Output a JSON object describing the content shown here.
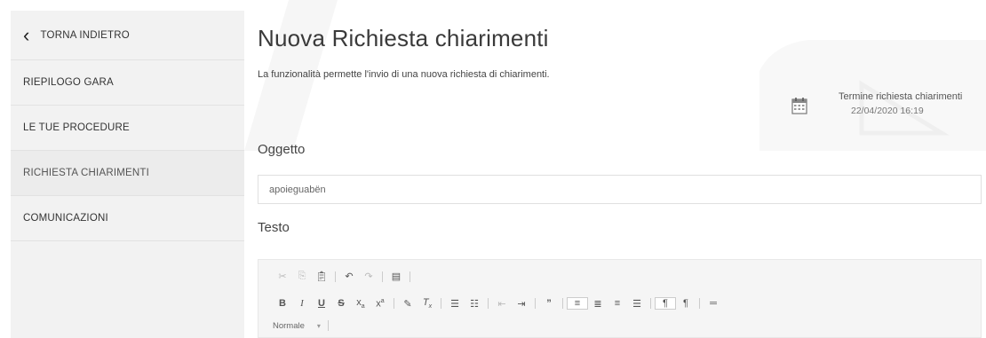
{
  "sidebar": {
    "back_label": "TORNA INDIETRO",
    "items": [
      {
        "label": "RIEPILOGO GARA"
      },
      {
        "label": "LE TUE PROCEDURE"
      },
      {
        "label": "RICHIESTA CHIARIMENTI",
        "active": true
      },
      {
        "label": "COMUNICAZIONI"
      }
    ]
  },
  "page": {
    "title": "Nuova Richiesta chiarimenti",
    "description": "La funzionalità permette l'invio di una nuova richiesta di chiarimenti."
  },
  "deadline": {
    "label": "Termine richiesta chiarimenti",
    "date": "22/04/2020 16:19"
  },
  "form": {
    "subject_label": "Oggetto",
    "subject_value": "apoieguabën",
    "text_label": "Testo"
  },
  "editor": {
    "toolbar_row1": [
      "✂",
      "⎘",
      "📋",
      "↶",
      "↷",
      "▤"
    ],
    "format_select": "Normale"
  }
}
